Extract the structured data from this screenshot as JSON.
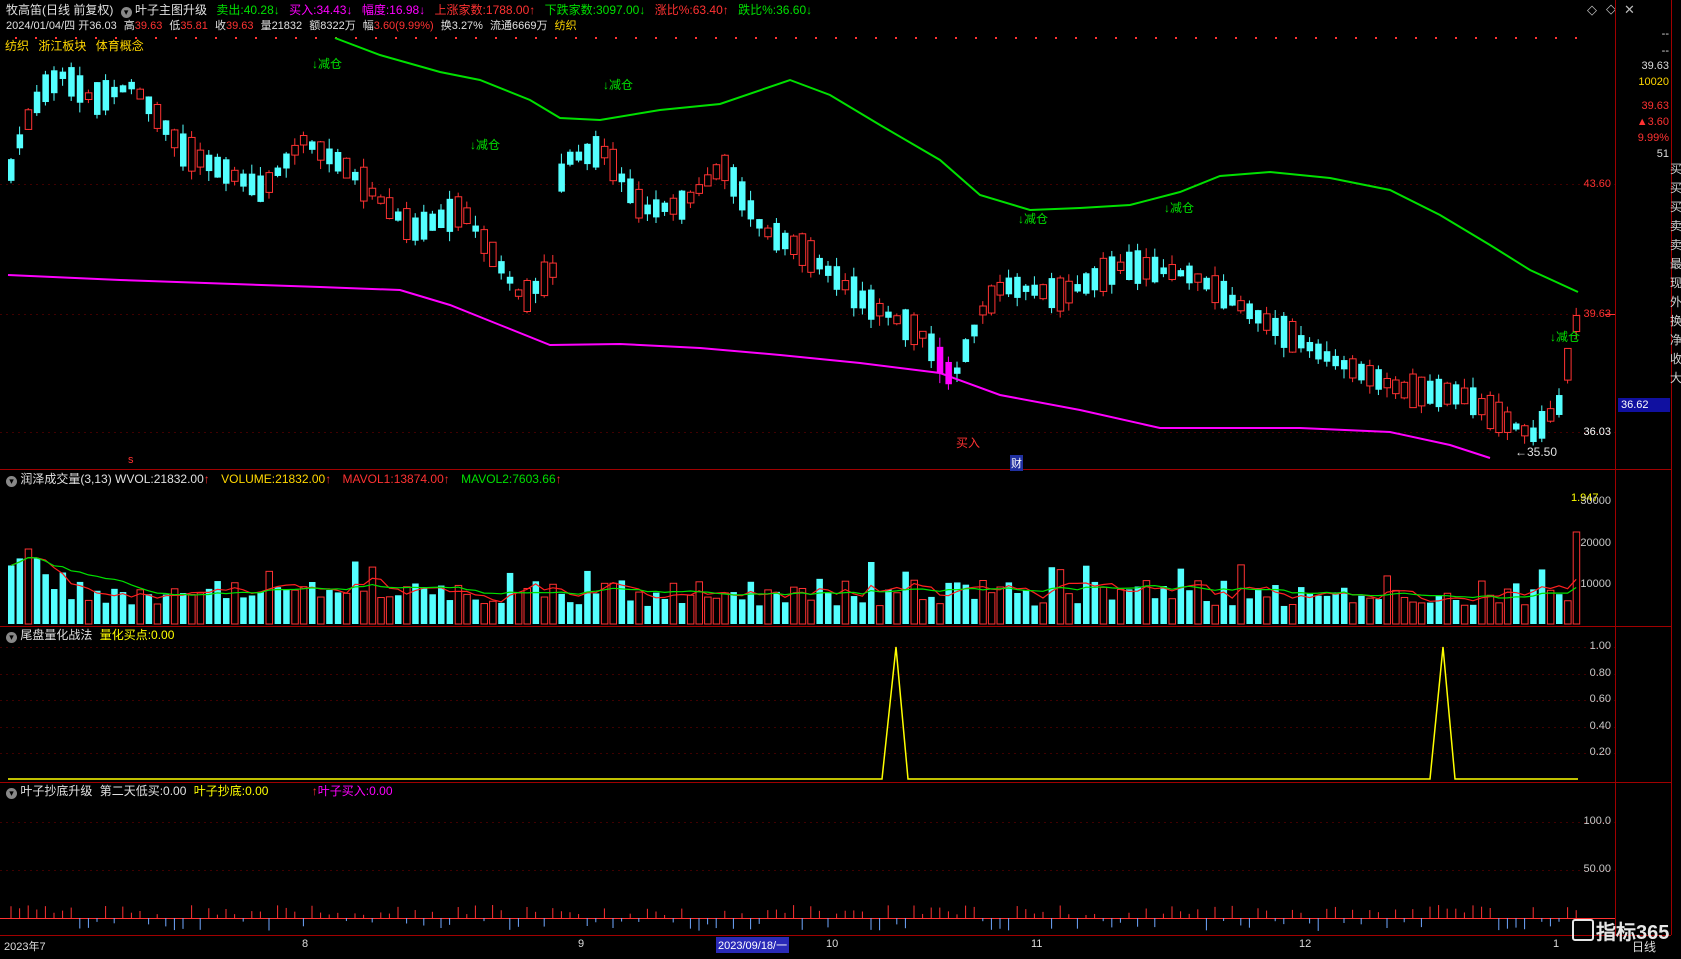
{
  "header": {
    "stock": "牧高笛",
    "mode": "(日线 前复权)",
    "indicator": "叶子主图升级",
    "sell_label": "卖出:",
    "sell_value": "40.28",
    "buy_label": "买入:",
    "buy_value": "34.43",
    "amp_label": "幅度:",
    "amp_value": "16.98",
    "up_count_label": "上涨家数:",
    "up_count_value": "1788.00",
    "down_count_label": "下跌家数:",
    "down_count_value": "3097.00",
    "up_ratio_label": "涨比%:",
    "up_ratio_value": "63.40",
    "down_ratio_label": "跌比%:",
    "down_ratio_value": "36.60"
  },
  "quote": {
    "date": "2024/01/04/四",
    "open_label": "开",
    "open": "36.03",
    "high_label": "高",
    "high": "39.63",
    "low_label": "低",
    "low": "35.81",
    "close_label": "收",
    "close": "39.63",
    "vol_label": "量",
    "vol": "21832",
    "amt_label": "额",
    "amt": "8322万",
    "chg_label": "幅",
    "chg": "3.60(9.99%)",
    "turn_label": "换",
    "turn": "3.27%",
    "float_label": "流通",
    "float": "6669万",
    "industry": "纺织"
  },
  "concepts": [
    "纺织",
    "浙江板块",
    "体育概念"
  ],
  "main_chart": {
    "price_labels": [
      "43.60",
      "39.63",
      "36.03"
    ],
    "current_price_badge": "36.62",
    "low_marker": "35.50",
    "reduce_label": "减仓",
    "buy_label": "买入",
    "finance_label": "财",
    "s_mark": "s",
    "colors": {
      "up": "#ff3232",
      "down": "#54ffff",
      "ma_long": "#ff00ff",
      "ma_mid": "#00e000"
    }
  },
  "right_panel": {
    "dash": "--",
    "price": "39.63",
    "volume": "10020",
    "price2": "39.63",
    "change": "▲3.60",
    "percent": "9.99%",
    "count": "51",
    "vertical_text": "买买买卖卖最现外换净收大"
  },
  "volume_panel": {
    "title": "润泽成交量(3,13)",
    "wvol_label": "WVOL:",
    "wvol": "21832.00",
    "volume_label": "VOLUME:",
    "volume": "21832.00",
    "mavol1_label": "MAVOL1:",
    "mavol1": "13874.00",
    "mavol2_label": "MAVOL2:",
    "mavol2": "7603.66",
    "ratio": "1.947",
    "axis": [
      "30000",
      "20000",
      "10000"
    ]
  },
  "quant_panel": {
    "title": "尾盘量化战法",
    "point_label": "量化买点:",
    "point_value": "0.00",
    "axis": [
      "1.00",
      "0.80",
      "0.60",
      "0.40",
      "0.20"
    ]
  },
  "bottom_panel": {
    "title": "叶子抄底升级",
    "second_label": "第二天低买:",
    "second_value": "0.00",
    "bottom_label": "叶子抄底:",
    "bottom_value": "0.00",
    "buy_label": "叶子买入:",
    "buy_value": "0.00",
    "axis": [
      "100.0",
      "50.00"
    ]
  },
  "x_axis": {
    "labels": [
      "2023年7",
      "8",
      "9",
      "10",
      "11",
      "12",
      "1"
    ],
    "cursor_date": "2023/09/18/一",
    "period": "日线"
  },
  "watermark": "指标365"
}
